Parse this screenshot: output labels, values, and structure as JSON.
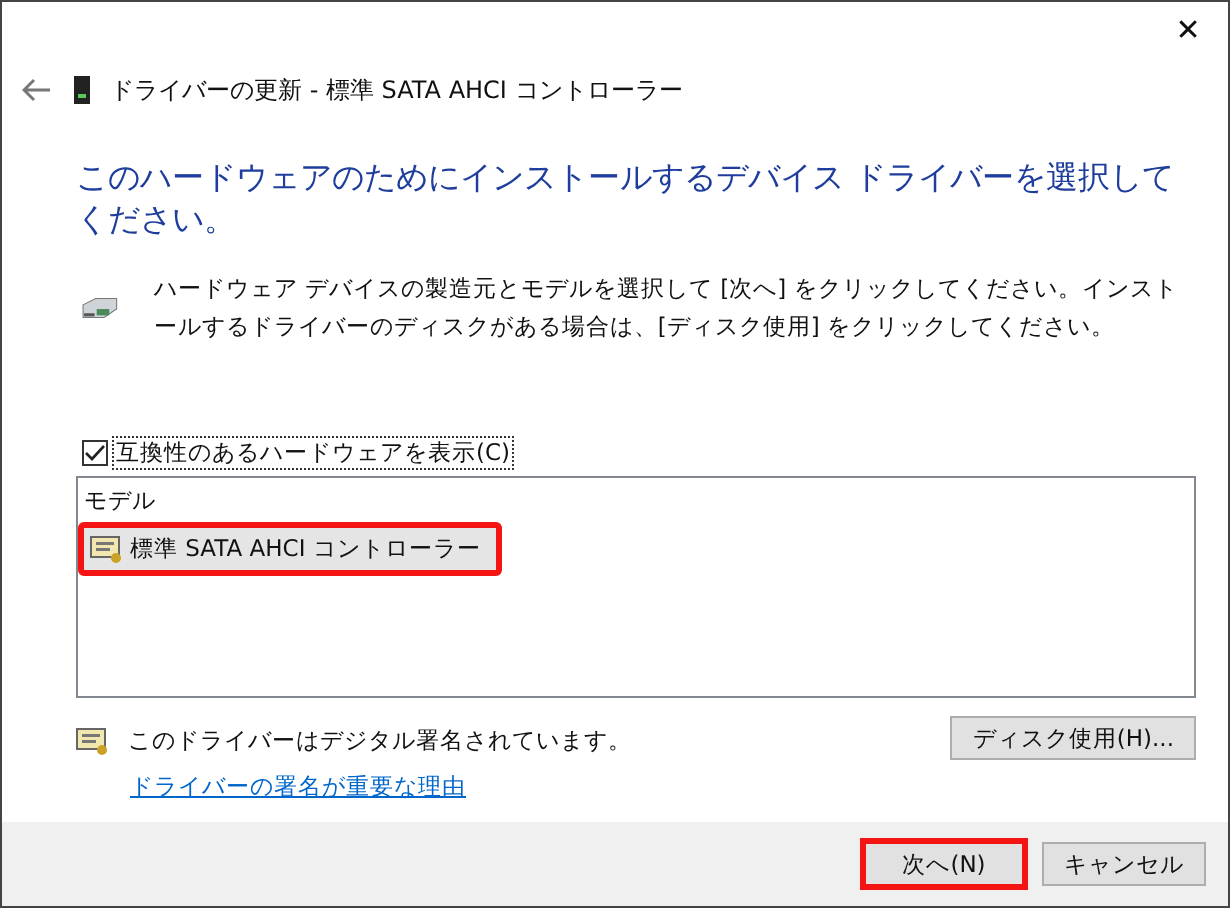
{
  "window": {
    "close_label": "✕"
  },
  "header": {
    "title": "ドライバーの更新 - 標準 SATA AHCI コントローラー"
  },
  "heading": "このハードウェアのためにインストールするデバイス ドライバーを選択してください。",
  "description": "ハードウェア デバイスの製造元とモデルを選択して [次へ] をクリックしてください。インストールするドライバーのディスクがある場合は、[ディスク使用] をクリックしてください。",
  "compatible_checkbox": {
    "label": "互換性のあるハードウェアを表示(C)",
    "checked": true
  },
  "model_list": {
    "column": "モデル",
    "items": [
      {
        "label": "標準 SATA AHCI コントローラー",
        "selected": true,
        "highlighted": true
      }
    ]
  },
  "signature": {
    "text": "このドライバーはデジタル署名されています。",
    "link": "ドライバーの署名が重要な理由"
  },
  "disk_button": "ディスク使用(H)...",
  "footer_buttons": [
    {
      "label": "次へ(N)",
      "highlighted": true
    },
    {
      "label": "キャンセル",
      "highlighted": false
    }
  ]
}
